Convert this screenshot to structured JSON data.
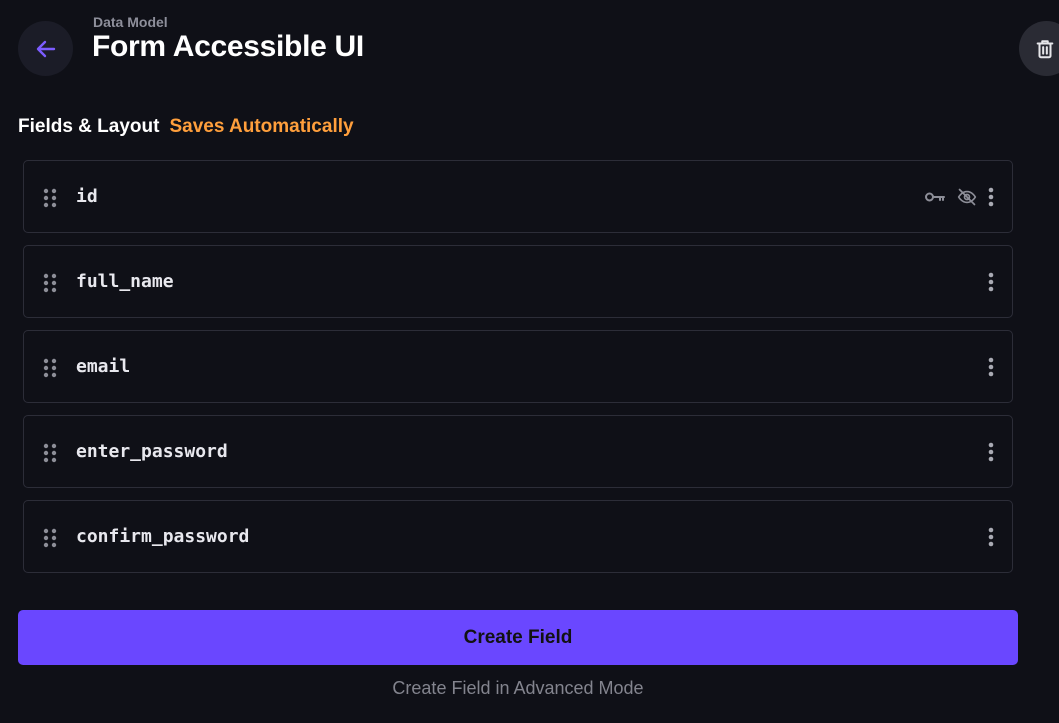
{
  "header": {
    "breadcrumb": "Data Model",
    "title": "Form Accessible UI",
    "back_icon": "arrow-left-icon",
    "delete_icon": "trash-icon"
  },
  "section": {
    "label": "Fields & Layout",
    "status": "Saves Automatically"
  },
  "fields": [
    {
      "name": "id",
      "icons": [
        "key-icon",
        "eye-off-icon",
        "kebab-menu-icon"
      ]
    },
    {
      "name": "full_name",
      "icons": [
        "kebab-menu-icon"
      ]
    },
    {
      "name": "email",
      "icons": [
        "kebab-menu-icon"
      ]
    },
    {
      "name": "enter_password",
      "icons": [
        "kebab-menu-icon"
      ]
    },
    {
      "name": "confirm_password",
      "icons": [
        "kebab-menu-icon"
      ]
    }
  ],
  "actions": {
    "create_label": "Create Field",
    "advanced_label": "Create Field in Advanced Mode"
  },
  "colors": {
    "background": "#0f1017",
    "accent": "#6a47ff",
    "status": "#ff9f3c",
    "row_border": "#2c2d38"
  }
}
